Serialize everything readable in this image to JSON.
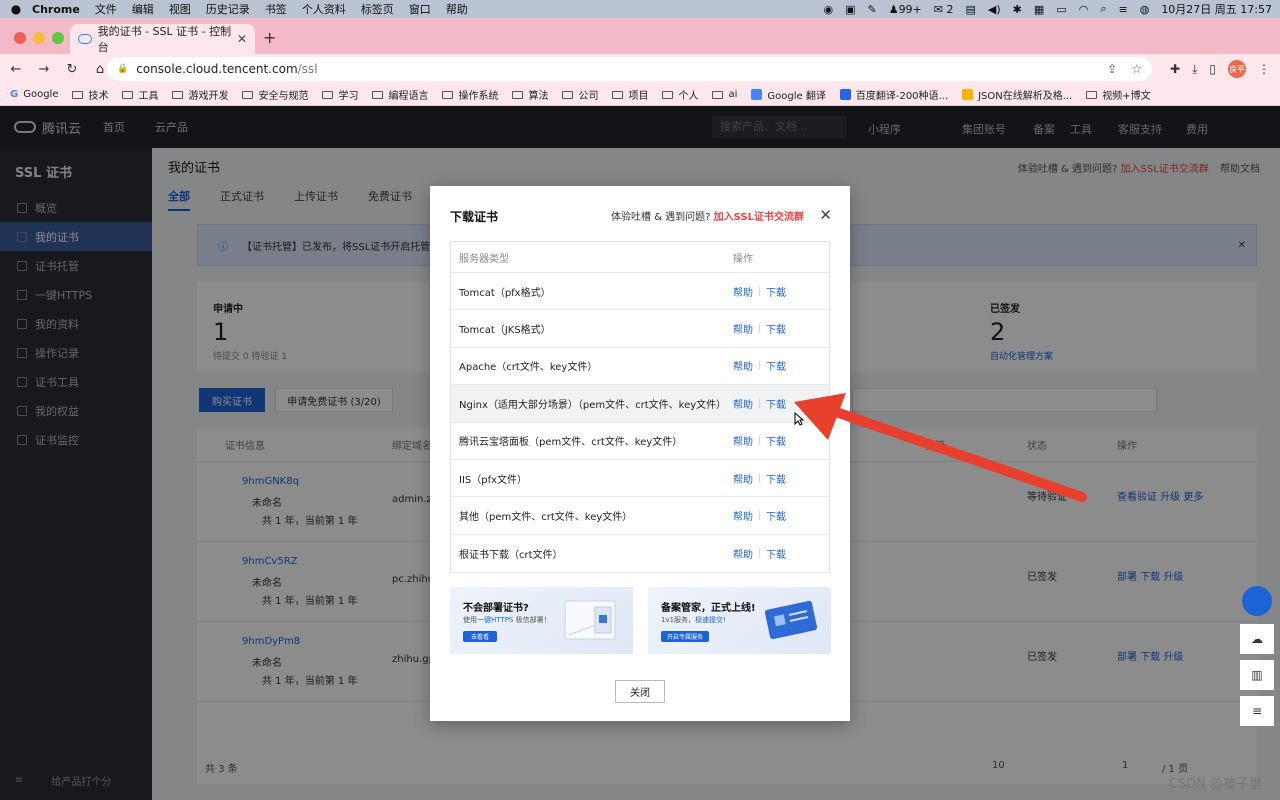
{
  "menubar": {
    "app": "Chrome",
    "items": [
      "文件",
      "编辑",
      "视图",
      "历史记录",
      "书签",
      "个人资料",
      "标签页",
      "窗口",
      "帮助"
    ],
    "status": {
      "badge": "99+",
      "wechat": "2",
      "datetime": "10月27日 周五  17:57"
    }
  },
  "browser": {
    "tab_title": "我的证书 - SSL 证书 - 控制台",
    "url_host": "console.cloud.tencent.com",
    "url_path": "/ssl",
    "avatar_text": "良平",
    "bookmarks": [
      "Google",
      "技术",
      "工具",
      "游戏开发",
      "安全与规范",
      "学习",
      "编程语言",
      "操作系统",
      "算法",
      "公司",
      "项目",
      "个人",
      "ai",
      "Google 翻译",
      "百度翻译-200种语...",
      "JSON在线解析及格...",
      "视频+博文"
    ]
  },
  "console": {
    "logo": "腾讯云",
    "home": "首页",
    "products": "云产品",
    "search_placeholder": "搜索产品、文档...",
    "topnav_items": [
      "小程序",
      "集团账号",
      "备案",
      "工具",
      "客服支持",
      "费用"
    ],
    "sidebar": {
      "title": "SSL 证书",
      "items": [
        "概览",
        "我的证书",
        "证书托管",
        "一键HTTPS",
        "我的资料",
        "操作记录",
        "证书工具",
        "我的权益",
        "证书监控"
      ],
      "footer": "给产品打个分"
    },
    "page_title": "我的证书",
    "page_links": {
      "prefix": "体验吐槽 & 遇到问题?",
      "link": "加入SSL证书交流群",
      "doc": "帮助文档"
    },
    "tabs": [
      "全部",
      "正式证书",
      "上传证书",
      "免费证书"
    ],
    "notice": "【证书托管】已发布，将SSL证书开启托管服...",
    "stats": [
      {
        "label": "申请中",
        "value": "1",
        "sub": "待提交 0    待验证 1"
      },
      {
        "label": "已签发",
        "value": "2",
        "sub": "自动化管理方案"
      }
    ],
    "buttons": {
      "buy": "购买证书",
      "apply_free": "申请免费证书 (3/20)"
    },
    "table_headers": [
      "证书信息",
      "绑定域名",
      "托管",
      "状态",
      "操作"
    ],
    "rows": [
      {
        "id": "9hmGNK8q",
        "name": "未命名",
        "period": "共 1 年，当前第 1 年",
        "domain": "admin.zhi",
        "status": "等待验证",
        "actions": "查看验证  升级  更多"
      },
      {
        "id": "9hmCv5RZ",
        "name": "未命名",
        "period": "共 1 年，当前第 1 年",
        "domain": "pc.zhihu",
        "status": "已签发",
        "actions": "部署  下载  升级"
      },
      {
        "id": "9hmDyPm8",
        "name": "未命名",
        "period": "共 1 年，当前第 1 年",
        "domain": "zhihu.gpt",
        "status": "已签发",
        "actions": "部署  下载  升级"
      }
    ],
    "pager": {
      "total": "共 3 条",
      "page_size": "10",
      "page": "1",
      "pages": "/ 1 页"
    }
  },
  "modal": {
    "title": "下载证书",
    "help_prefix": "体验吐槽 & 遇到问题?",
    "help_link": "加入SSL证书交流群",
    "col_server": "服务器类型",
    "col_action": "操作",
    "help_label": "帮助",
    "download_label": "下载",
    "rows": [
      "Tomcat（pfx格式）",
      "Tomcat（JKS格式）",
      "Apache（crt文件、key文件）",
      "Nginx（适用大部分场景）（pem文件、crt文件、key文件）",
      "腾讯云宝塔面板（pem文件、crt文件、key文件）",
      "IIS（pfx文件）",
      "其他（pem文件、crt文件、key文件）",
      "根证书下载（crt文件）"
    ],
    "highlighted_row": 3,
    "banner1": {
      "title": "不会部署证书?",
      "sub_prefix": "使用",
      "sub_link": "一键HTTPS",
      "sub_suffix": " 极信部署！",
      "button": "去看看"
    },
    "banner2": {
      "title": "备案管家，正式上线!",
      "sub_prefix": "1v1服务，",
      "sub_link": "极速提交!",
      "sub_suffix": "",
      "button": "开启专属服务"
    },
    "close_button": "关闭"
  },
  "watermark": "CSDN @被子里",
  "colors": {
    "accent": "#1e63d6",
    "red": "#e54545",
    "arrow": "#e8402d"
  }
}
